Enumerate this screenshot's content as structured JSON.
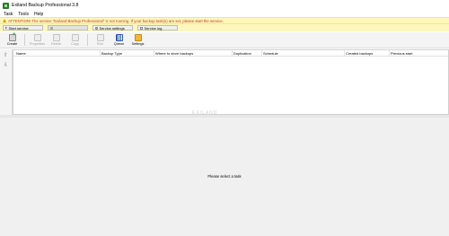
{
  "window": {
    "title": "Exiland Backup Professional 3.8",
    "icon": "app-icon"
  },
  "menu": [
    "Task",
    "Tools",
    "Help"
  ],
  "alert": {
    "text": "ATTENTION! The service \"Exiland Backup Professional\" is not running. If your backup task(s) are set, please start the service.",
    "icon": "warning-icon",
    "color": "#c0392b",
    "background": "#fdf7bd"
  },
  "service_buttons": [
    {
      "label": "Start service",
      "icon": "play-icon",
      "enabled": true
    },
    {
      "label": "",
      "icon": "stop-icon",
      "enabled": false
    },
    {
      "label": "Service settings",
      "icon": "gear-icon",
      "enabled": true
    },
    {
      "label": "Service log",
      "icon": "log-icon",
      "enabled": true
    }
  ],
  "toolbar": [
    {
      "label": "Create",
      "icon": "create-icon",
      "enabled": true
    },
    {
      "label": "Properties",
      "icon": "properties-icon",
      "enabled": false
    },
    {
      "label": "Delete",
      "icon": "delete-icon",
      "enabled": false
    },
    {
      "label": "Copy",
      "icon": "copy-icon",
      "enabled": false
    },
    {
      "label": "Run",
      "icon": "run-icon",
      "enabled": false
    },
    {
      "label": "Queue",
      "icon": "queue-icon",
      "enabled": true
    },
    {
      "label": "Settings",
      "icon": "settings-icon",
      "enabled": true
    }
  ],
  "table": {
    "columns": [
      "Name",
      "Backup Type",
      "Where to store backups",
      "Duplication",
      "Schedule",
      "Created backups",
      "Previous start"
    ],
    "rows": []
  },
  "watermark": "EXILAND",
  "detail": {
    "placeholder": "Please select a task"
  }
}
